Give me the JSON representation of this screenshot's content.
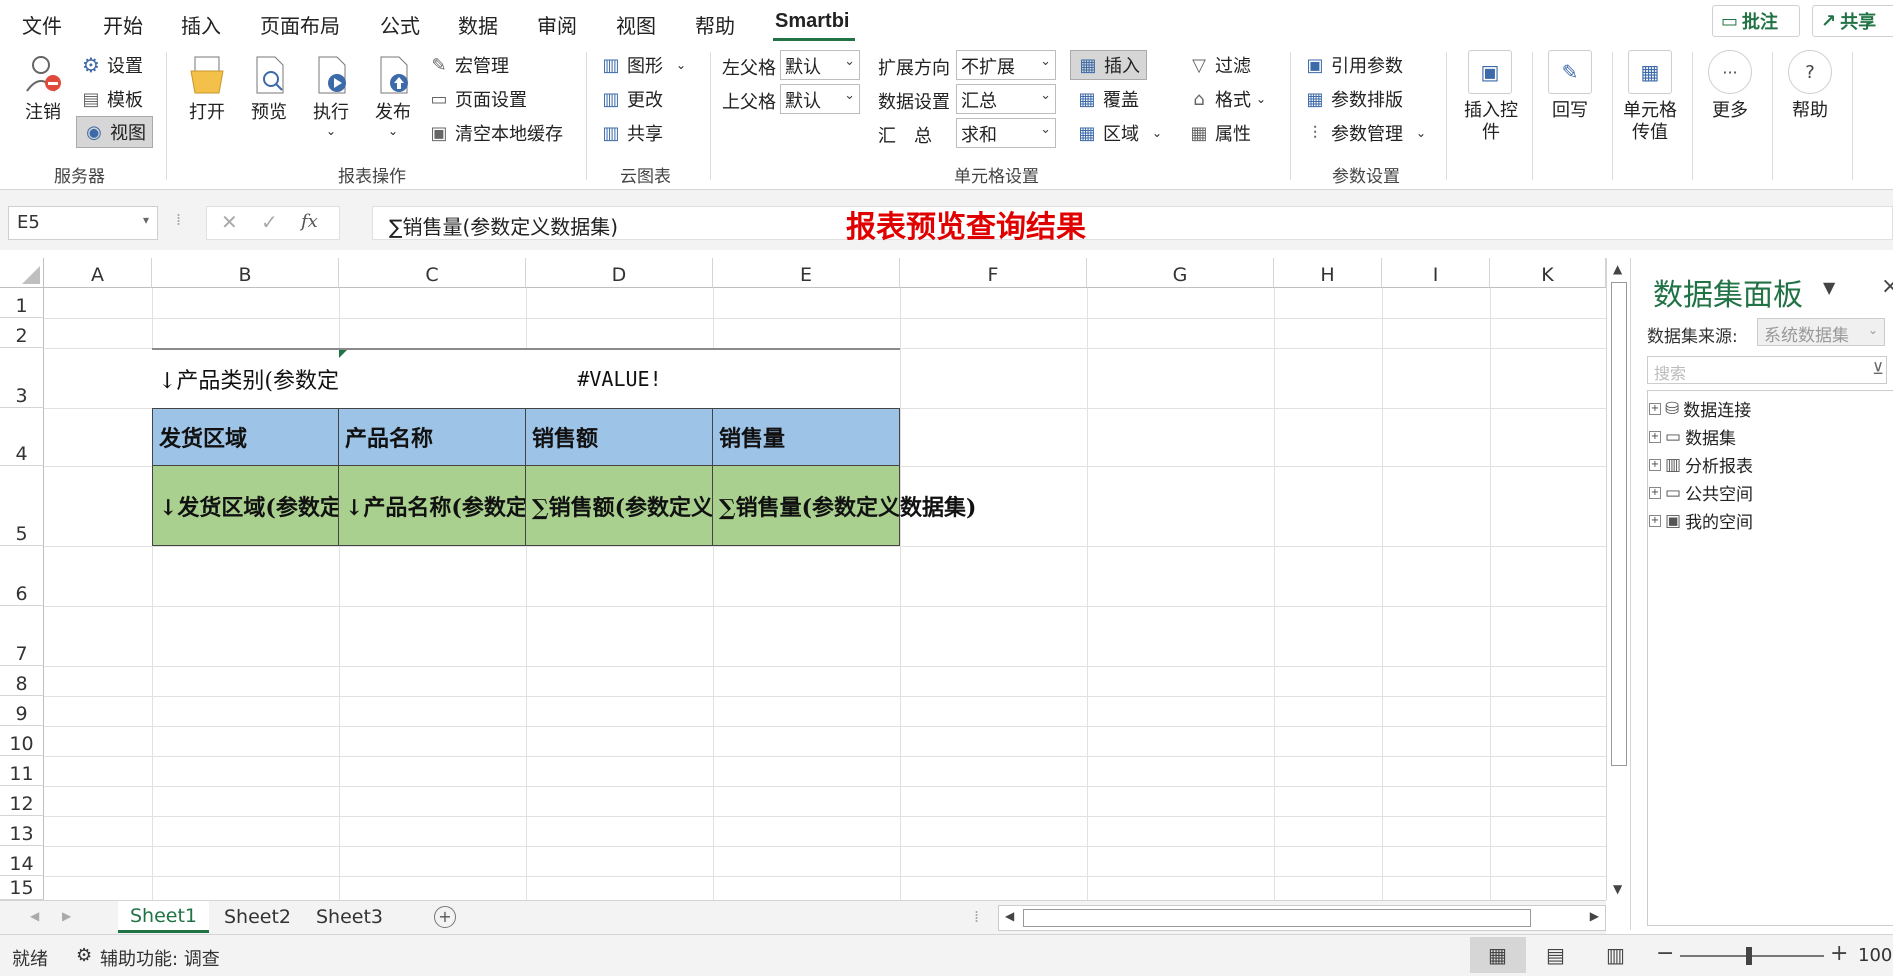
{
  "menu": {
    "items": [
      "文件",
      "开始",
      "插入",
      "页面布局",
      "公式",
      "数据",
      "审阅",
      "视图",
      "帮助",
      "Smartbi"
    ],
    "active": "Smartbi",
    "comment": "批注",
    "share": "共享"
  },
  "ribbon": {
    "server": {
      "logout": "注销",
      "settings": "设置",
      "template": "模板",
      "view": "视图",
      "group": "服务器"
    },
    "report_ops": {
      "open": "打开",
      "preview": "预览",
      "execute": "执行",
      "publish": "发布",
      "macro": "宏管理",
      "page_setup": "页面设置",
      "clear_cache": "清空本地缓存",
      "group": "报表操作"
    },
    "cloud_chart": {
      "shape": "图形",
      "change": "更改",
      "share": "共享",
      "group": "云图表"
    },
    "cell_settings": {
      "left_parent": "左父格",
      "top_parent": "上父格",
      "left_parent_value": "默认",
      "top_parent_value": "默认",
      "expand_dir": "扩展方向",
      "expand_value": "不扩展",
      "data_setting": "数据设置",
      "data_value": "汇总",
      "summary": "汇　总",
      "summary_value": "求和",
      "insert": "插入",
      "cover": "覆盖",
      "region": "区域",
      "filter": "过滤",
      "format": "格式",
      "attributes": "属性",
      "group": "单元格设置"
    },
    "param_settings": {
      "ref_param": "引用参数",
      "param_layout": "参数排版",
      "param_mgmt": "参数管理",
      "group": "参数设置"
    },
    "insert_ctrl": "插入控件",
    "writeback": "回写",
    "cell_pass": "单元格传值",
    "more": "更多",
    "help": "帮助"
  },
  "formula_bar": {
    "name_box": "E5",
    "formula": "∑销售量(参数定义数据集)",
    "annotation": "报表预览查询结果",
    "fx": "fx"
  },
  "columns": [
    "A",
    "B",
    "C",
    "D",
    "E",
    "F",
    "G",
    "H",
    "I",
    "K"
  ],
  "rows": [
    "1",
    "2",
    "3",
    "4",
    "5",
    "6",
    "7",
    "8",
    "9",
    "10",
    "11",
    "12",
    "13",
    "14",
    "15"
  ],
  "cells": {
    "b3": "↓产品类别(参数定义数据集)",
    "c3": "#VALUE!",
    "b4": "发货区域",
    "c4": "产品名称",
    "d4": "销售额",
    "e4": "销售量",
    "b5": "↓发货区域(参数定义数据集)",
    "c5": "↓产品名称(参数定义数据集)",
    "d5": "∑销售额(参数定义数据集)",
    "e5": "∑销售量(参数定义数据集)"
  },
  "panel": {
    "title": "数据集面板",
    "source_label": "数据集来源:",
    "source_value": "系统数据集",
    "search_placeholder": "搜索",
    "tree": [
      "数据连接",
      "数据集",
      "分析报表",
      "公共空间",
      "我的空间"
    ]
  },
  "sheets": [
    "Sheet1",
    "Sheet2",
    "Sheet3"
  ],
  "status": {
    "ready": "就绪",
    "accessibility": "辅助功能: 调查",
    "zoom": "100"
  },
  "colors": {
    "header_blue": "#9dc3e6",
    "data_green": "#a9d08e",
    "annotation_red": "#e00000",
    "accent": "#217346"
  }
}
